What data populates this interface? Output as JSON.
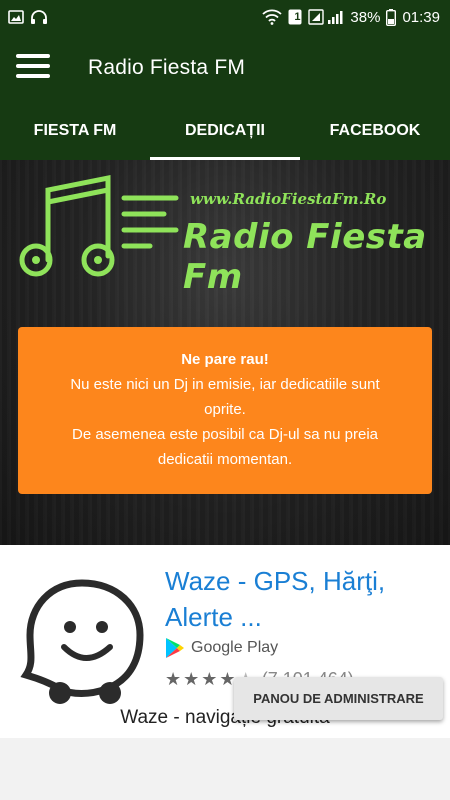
{
  "status_bar": {
    "battery_percent": "38%",
    "time": "01:39",
    "notification_count": "1",
    "icons": [
      "image-icon",
      "headphones-icon",
      "wifi-icon",
      "signal-icon",
      "battery-icon"
    ]
  },
  "app_bar": {
    "title": "Radio Fiesta FM",
    "menu_icon": "menu-icon"
  },
  "tabs": [
    {
      "label": "FIESTA FM",
      "active": false
    },
    {
      "label": "DEDICAȚII",
      "active": true
    },
    {
      "label": "FACEBOOK",
      "active": false
    }
  ],
  "hero": {
    "logo_url": "www.RadioFiestaFm.Ro",
    "logo_name": "Radio Fiesta Fm",
    "accent": "#8fe35a"
  },
  "notice": {
    "title": "Ne pare rau!",
    "line1": "Nu este nici un Dj in emisie, iar dedicatiile sunt",
    "line2": "oprite.",
    "line3": "De asemenea este posibil ca Dj-ul sa nu preia",
    "line4": "dedicatii momentan.",
    "color": "#fd861c"
  },
  "ad": {
    "title_line1": "Waze - GPS, Hărţi,",
    "title_line2": "Alerte ...",
    "store": "Google Play",
    "rating_count": "(7.101.464)",
    "description": "Waze - navigație gratuită",
    "title_color": "#1a7fd4"
  },
  "admin_button": {
    "label": "PANOU DE ADMINISTRARE"
  },
  "colors": {
    "app_bar": "#163a12"
  }
}
